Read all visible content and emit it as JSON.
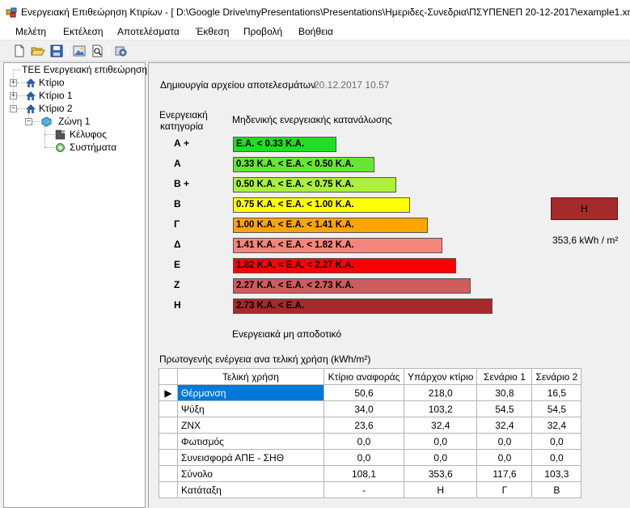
{
  "window": {
    "title": "Ενεργειακή Επιθεώρηση Κτιρίων - [ D:\\Google Drive\\myPresentations\\Presentations\\Ημεριδες-Συνεδρια\\ΠΣΥΠΕΝΕΠ 20-12-2017\\example1.xm"
  },
  "menu": [
    "Μελέτη",
    "Εκτέλεση",
    "Αποτελέσματα",
    "Έκθεση",
    "Προβολή",
    "Βοήθεια"
  ],
  "toolbar": {
    "icons": [
      "new-file-icon",
      "open-folder-icon",
      "save-icon",
      "image-icon",
      "print-preview-icon",
      "settings-icon"
    ]
  },
  "tree": {
    "root": "ΤΕΕ Ενεργειακή επιθεώρηση",
    "k0": "Κτίριο",
    "k1": "Κτίριο 1",
    "k2": "Κτίριο 2",
    "zone": "Ζώνη 1",
    "shell": "Κέλυφος",
    "systems": "Συστήματα"
  },
  "results": {
    "created_label": "Δημιουργία αρχείου αποτελεσμάτων",
    "created_value": "20.12.2017 10.57",
    "cat_header_1": "Ενεργειακή",
    "cat_header_2": "κατηγορία",
    "zero_label": "Μηδενικής ενεργειακής κατανάλωσης",
    "nonefficient_label": "Ενεργειακά μη αποδοτικό",
    "rating_value": "Η",
    "consumption_value": "353,6 kWh / m²",
    "categories": [
      {
        "label": "Α +",
        "range": "Ε.Α. < 0.33 Κ.Α.",
        "color": "#22dd22",
        "width": 128
      },
      {
        "label": "Α",
        "range": "0.33 Κ.Α. <  Ε.Α. < 0.50 Κ.Α.",
        "color": "#66e633",
        "width": 175
      },
      {
        "label": "Β +",
        "range": "0.50 Κ.Α. <  Ε.Α. < 0.75 Κ.Α.",
        "color": "#aaf03c",
        "width": 202
      },
      {
        "label": "Β",
        "range": "0.75 Κ.Α. <  Ε.Α. < 1.00 Κ.Α.",
        "color": "#ffff00",
        "width": 219
      },
      {
        "label": "Γ",
        "range": "1.00 Κ.Α. <  Ε.Α. < 1.41 Κ.Α.",
        "color": "#ffa500",
        "width": 241
      },
      {
        "label": "Δ",
        "range": "1.41 Κ.Α. <  Ε.Α. < 1.82 Κ.Α.",
        "color": "#f4857a",
        "width": 259
      },
      {
        "label": "Ε",
        "range": "1.82 Κ.Α. <  Ε.Α. < 2.27 Κ.Α.",
        "color": "#ff0000",
        "width": 276
      },
      {
        "label": "Ζ",
        "range": "2.27 Κ.Α. <  Ε.Α. < 2.73 Κ.Α.",
        "color": "#cd5c5c",
        "width": 294
      },
      {
        "label": "Η",
        "range": "2.73 Κ.Α. <  Ε.Α.",
        "color": "#a52a2a",
        "width": 321
      }
    ]
  },
  "table": {
    "caption": "Πρωτογενής ενέργεια ανα τελική χρήση (kWh/m²)",
    "headers": [
      "Τελική χρήση",
      "Κτίριο αναφοράς",
      "Υπάρχον κτίριο",
      "Σενάριο 1",
      "Σενάριο 2"
    ],
    "rows": [
      [
        "Θέρμανση",
        "50,6",
        "218,0",
        "30,8",
        "16,5"
      ],
      [
        "Ψύξη",
        "34,0",
        "103,2",
        "54,5",
        "54,5"
      ],
      [
        "ΖΝΧ",
        "23,6",
        "32,4",
        "32,4",
        "32,4"
      ],
      [
        "Φωτισμός",
        "0,0",
        "0,0",
        "0,0",
        "0,0"
      ],
      [
        "Συνεισφορά ΑΠΕ - ΣΗΘ",
        "0,0",
        "0,0",
        "0,0",
        "0,0"
      ],
      [
        "Σύνολο",
        "108,1",
        "353,6",
        "117,6",
        "103,3"
      ],
      [
        "Κατάταξη",
        "-",
        "Η",
        "Γ",
        "Β"
      ]
    ],
    "selected_indicator": "▶"
  }
}
